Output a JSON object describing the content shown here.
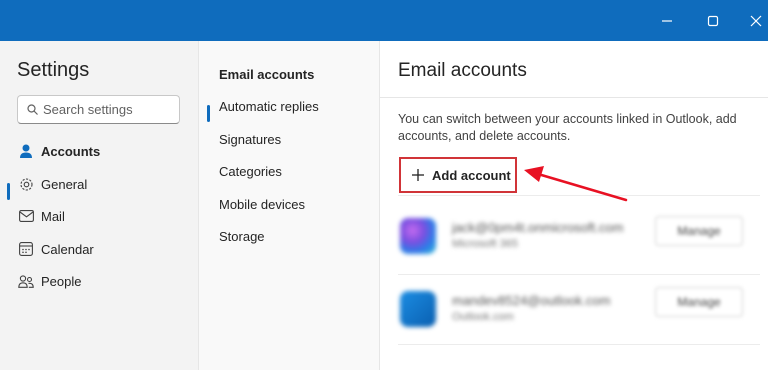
{
  "window": {
    "controls": [
      "minimize",
      "maximize",
      "close"
    ]
  },
  "leftnav": {
    "title": "Settings",
    "search_placeholder": "Search settings",
    "items": [
      {
        "label": "Accounts",
        "icon": "person-icon",
        "selected": true
      },
      {
        "label": "General",
        "icon": "gear-icon",
        "selected": false
      },
      {
        "label": "Mail",
        "icon": "mail-icon",
        "selected": false
      },
      {
        "label": "Calendar",
        "icon": "calendar-icon",
        "selected": false
      },
      {
        "label": "People",
        "icon": "people-icon",
        "selected": false
      }
    ]
  },
  "midnav": {
    "items": [
      {
        "label": "Email accounts",
        "selected": true
      },
      {
        "label": "Automatic replies",
        "selected": false
      },
      {
        "label": "Signatures",
        "selected": false
      },
      {
        "label": "Categories",
        "selected": false
      },
      {
        "label": "Mobile devices",
        "selected": false
      },
      {
        "label": "Storage",
        "selected": false
      }
    ]
  },
  "content": {
    "title": "Email accounts",
    "description": "You can switch between your accounts linked in Outlook, add accounts, and delete accounts.",
    "add_account_label": "Add account",
    "accounts": [
      {
        "email": "jack@0pm4t.onmicrosoft.com",
        "type": "Microsoft 365",
        "manage_label": "Manage"
      },
      {
        "email": "mandev8524@outlook.com",
        "type": "Outlook.com",
        "manage_label": "Manage"
      }
    ]
  },
  "colors": {
    "titlebar": "#0f6cbd",
    "accent": "#0f6cbd",
    "highlight_box": "#d13438",
    "annotation_arrow": "#e81123"
  }
}
